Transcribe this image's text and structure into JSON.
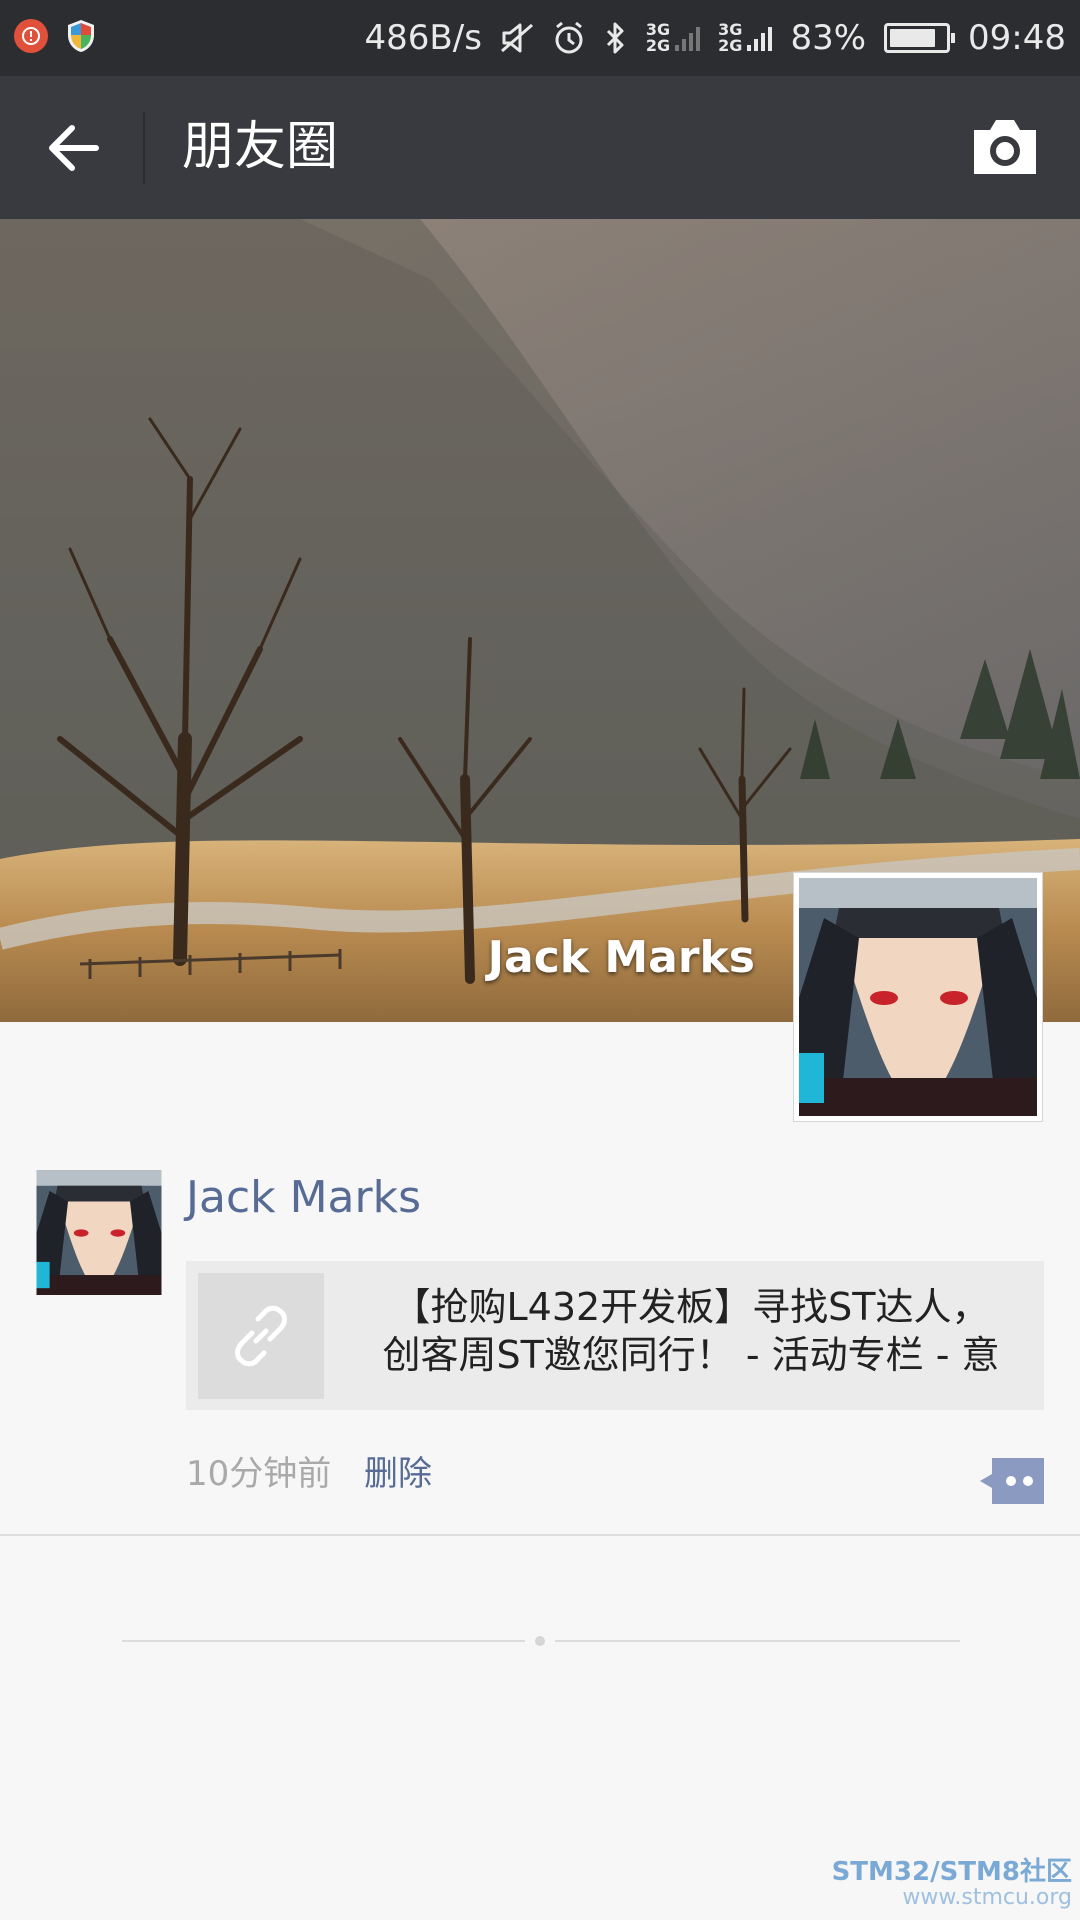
{
  "status_bar": {
    "net_speed": "486B/s",
    "signal1_top": "3G",
    "signal1_bottom": "2G",
    "signal2_top": "3G",
    "signal2_bottom": "2G",
    "battery_percent": "83%",
    "battery_level": 0.83,
    "time": "09:48"
  },
  "action_bar": {
    "title": "朋友圈",
    "background": "#393a3f"
  },
  "profile": {
    "cover_name": "Jack Marks"
  },
  "post": {
    "author": "Jack Marks",
    "link_title": "【抢购L432开发板】寻找ST达人，\n创客周ST邀您同行！ - 活动专栏 - 意",
    "time": "10分钟前",
    "delete_label": "删除",
    "name_color": "#576b95"
  },
  "watermark": {
    "line1": "STM32/STM8社区",
    "line2": "www.stmcu.org"
  }
}
